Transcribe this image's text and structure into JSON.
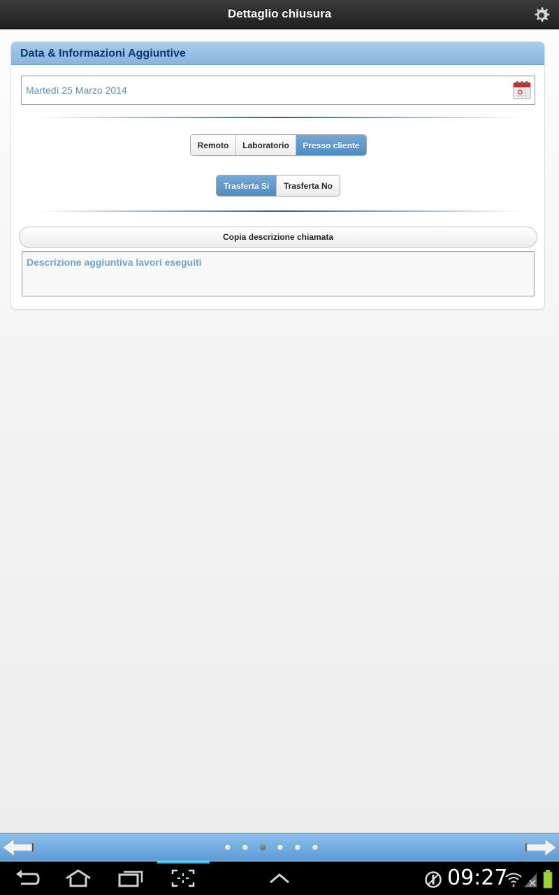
{
  "header": {
    "title": "Dettaglio chiusura",
    "settings_icon": "gear-icon"
  },
  "panel": {
    "title": "Data & Informazioni Aggiuntive",
    "date_value": "Martedì 25 Marzo 2014",
    "calendar_icon": "calendar-icon",
    "location_options": [
      {
        "label": "Remoto",
        "selected": false
      },
      {
        "label": "Laboratorio",
        "selected": false
      },
      {
        "label": "Presso cliente",
        "selected": true
      }
    ],
    "travel_options": [
      {
        "label": "Trasferta Si",
        "selected": true
      },
      {
        "label": "Trasferta No",
        "selected": false
      }
    ],
    "copy_button_label": "Copia descrizione chiamata",
    "description_placeholder": "Descrizione aggiuntiva lavori eseguiti"
  },
  "pager": {
    "page_count": 6,
    "current_page": 3
  },
  "system_bar": {
    "time": "09:27"
  },
  "colors": {
    "accent": "#4f8cc4",
    "header_bg": "#2a2a2a",
    "panel_head_bg": "#94bfe4",
    "footer_bg": "#74ace0",
    "system_highlight": "#33b5e5"
  }
}
